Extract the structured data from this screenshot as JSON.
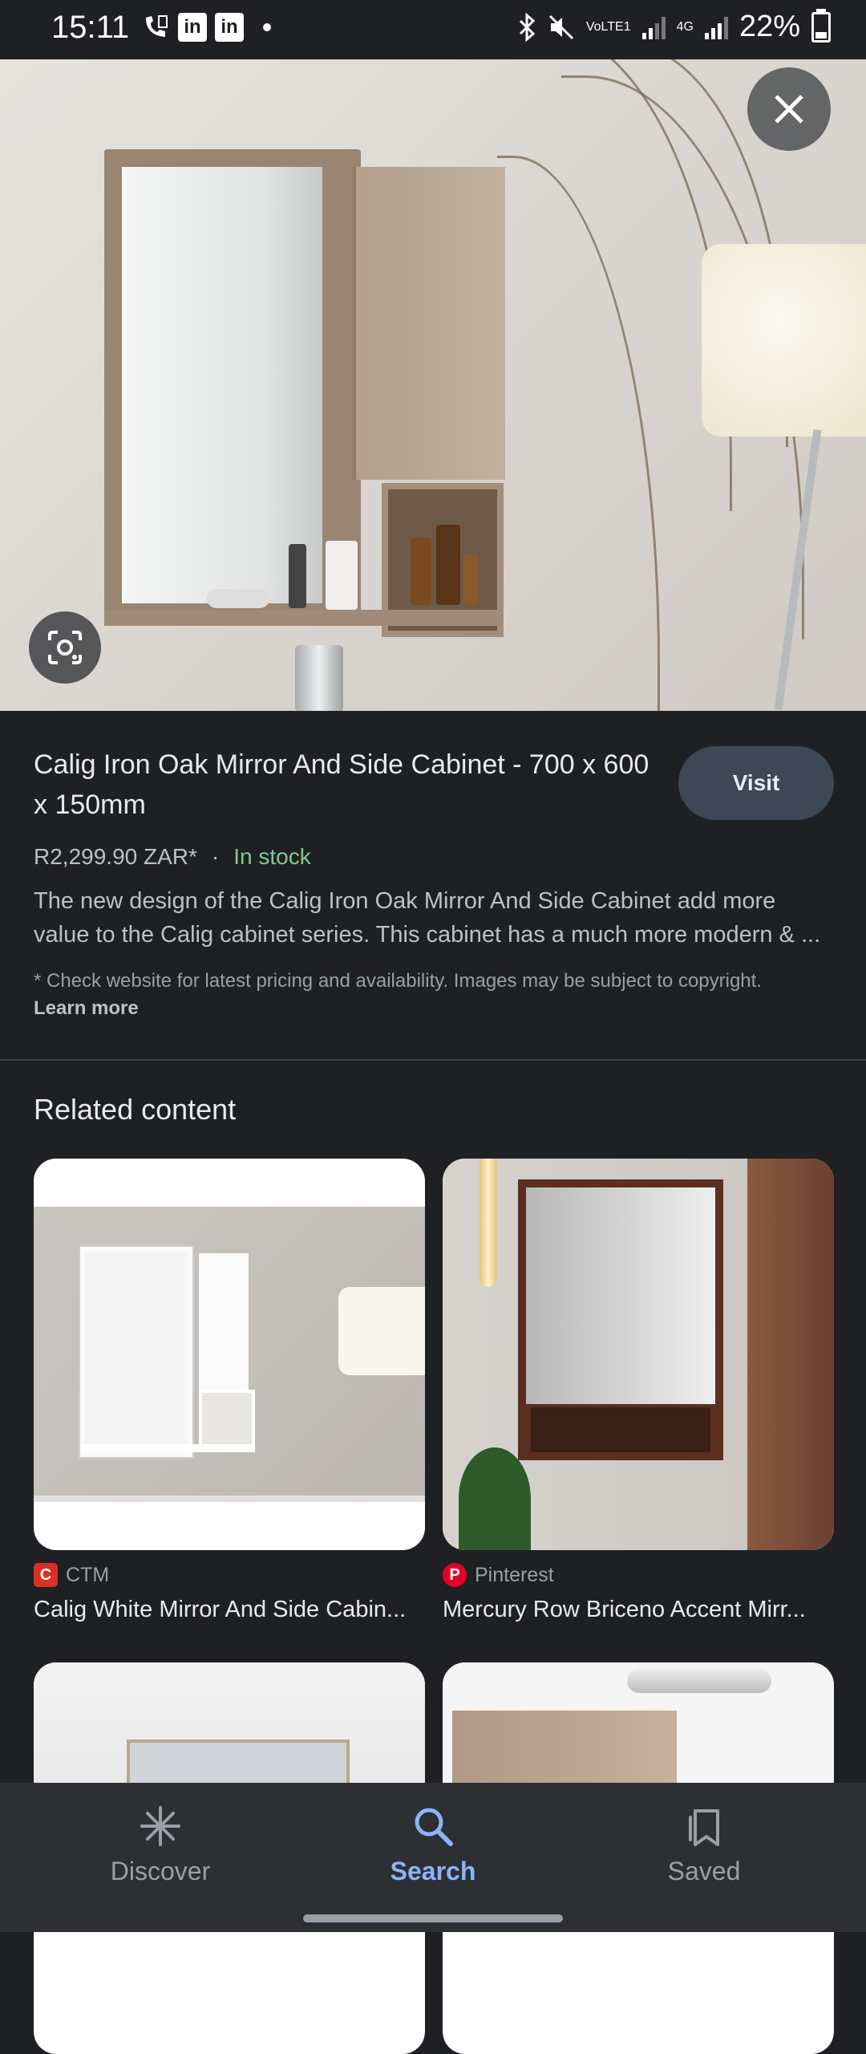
{
  "status_bar": {
    "time": "15:11",
    "battery": "22%",
    "battery_level": 0.22,
    "network_label_1": "VoLTE1",
    "network_label_2": "4G",
    "icons": [
      "call-wifi-icon",
      "linkedin-icon",
      "linkedin-icon",
      "bluetooth-icon",
      "mute-icon",
      "signal-icon",
      "battery-icon"
    ]
  },
  "product": {
    "title": "Calig Iron Oak Mirror And Side Cabinet - 700 x 600 x 150mm",
    "visit_label": "Visit",
    "price": "R2,299.90 ZAR*",
    "separator": "·",
    "stock": "In stock",
    "description": "The new design of the Calig Iron Oak Mirror And Side Cabinet add more value to the Calig cabinet series. This cabinet has a much more modern & ...",
    "disclaimer": "* Check website for latest pricing and availability. Images may be subject to copyright.",
    "learn_more": "Learn more"
  },
  "related": {
    "heading": "Related content",
    "items": [
      {
        "source": "CTM",
        "title": "Calig White Mirror And Side Cabin..."
      },
      {
        "source": "Pinterest",
        "title": "Mercury Row Briceno Accent Mirr..."
      }
    ]
  },
  "nav": {
    "items": [
      {
        "label": "Discover",
        "icon": "asterisk-icon"
      },
      {
        "label": "Search",
        "icon": "search-icon"
      },
      {
        "label": "Saved",
        "icon": "bookmarks-icon"
      }
    ],
    "active": "Search"
  },
  "colors": {
    "background": "#1f2023",
    "accent": "#8ab4f8",
    "stock_green": "#81c995",
    "visit_button": "#3d4756"
  }
}
